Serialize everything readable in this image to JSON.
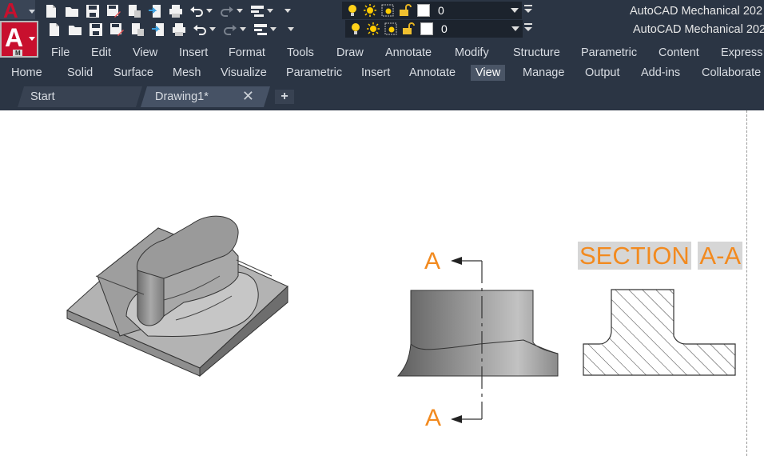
{
  "app": {
    "title": "AutoCAD Mechanical 202",
    "logo_letter": "A",
    "logo_badge": "M"
  },
  "layer": {
    "name": "0",
    "icons": [
      "lightbulb-icon",
      "sun-icon",
      "freeze-viewport-icon",
      "lock-icon"
    ]
  },
  "quick_access": [
    "new-icon",
    "open-icon",
    "save-icon",
    "save-as-icon",
    "publish-icon",
    "import-icon",
    "plot-icon",
    "undo-icon",
    "redo-icon",
    "workspace-icon"
  ],
  "menus": [
    "File",
    "Edit",
    "View",
    "Insert",
    "Format",
    "Tools",
    "Draw",
    "Annotate",
    "Modify",
    "Structure",
    "Parametric",
    "Content",
    "Express"
  ],
  "ribbon_tabs": [
    "Home",
    "Solid",
    "Surface",
    "Mesh",
    "Visualize",
    "Parametric",
    "Insert",
    "Annotate",
    "View",
    "Manage",
    "Output",
    "Add-ins",
    "Collaborate"
  ],
  "ribbon_active": "View",
  "doc_tabs": [
    {
      "label": "Start"
    },
    {
      "label": "Drawing1*"
    }
  ],
  "drawing": {
    "section_title_word": "SECTION",
    "section_title_id": "A-A",
    "cut_label_top": "A",
    "cut_label_bottom": "A"
  },
  "colors": {
    "chrome_bg": "#2b3544",
    "accent_orange": "#f28a1f",
    "logo_red": "#c8102e",
    "active_tab": "#4a5566"
  }
}
